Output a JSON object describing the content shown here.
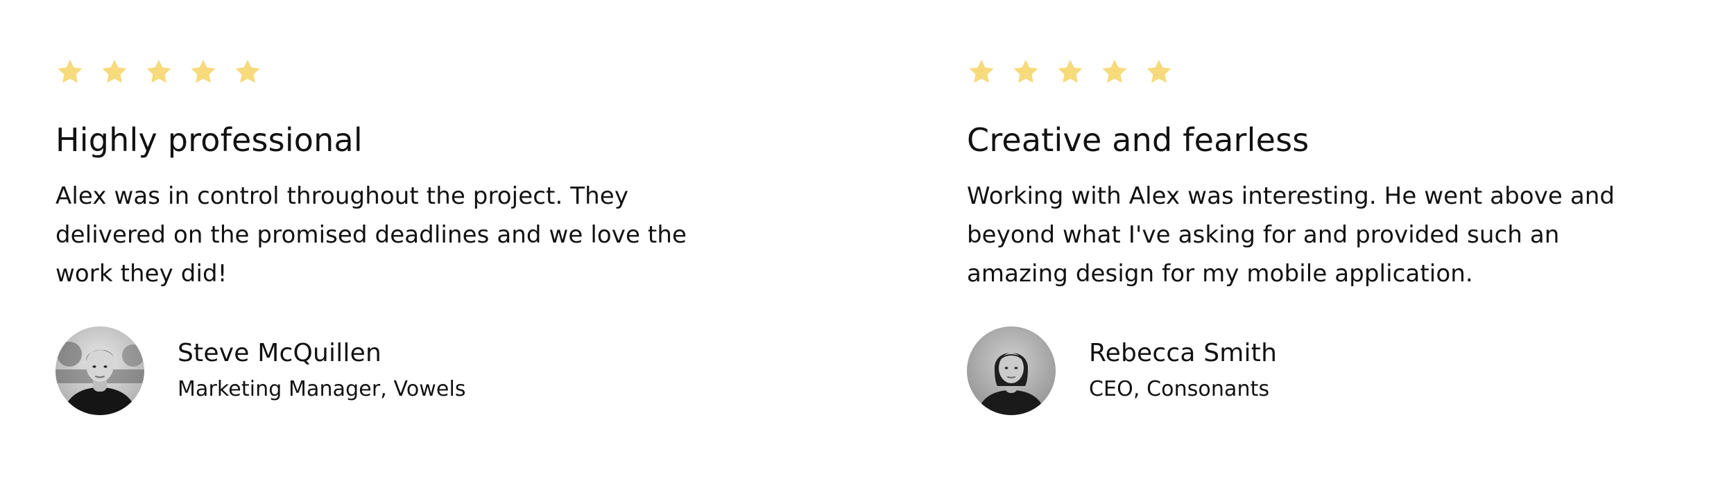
{
  "theme": {
    "star_color": "#F6DA7C",
    "text_color": "#111111",
    "background": "#FFFFFF"
  },
  "testimonials": [
    {
      "rating": 5,
      "rating_max": 5,
      "title": "Highly professional",
      "body": "Alex was in control throughout the project. They delivered on the promised deadlines and we love the work they did!",
      "author": {
        "name": "Steve McQuillen",
        "role": "Marketing Manager, Vowels",
        "avatar_icon": "person-avatar-icon"
      }
    },
    {
      "rating": 5,
      "rating_max": 5,
      "title": "Creative and fearless",
      "body": "Working with Alex was interesting. He went above and beyond what I've asking for and provided such an amazing design for my mobile application.",
      "author": {
        "name": "Rebecca Smith",
        "role": "CEO, Consonants",
        "avatar_icon": "person-avatar-icon"
      }
    }
  ]
}
